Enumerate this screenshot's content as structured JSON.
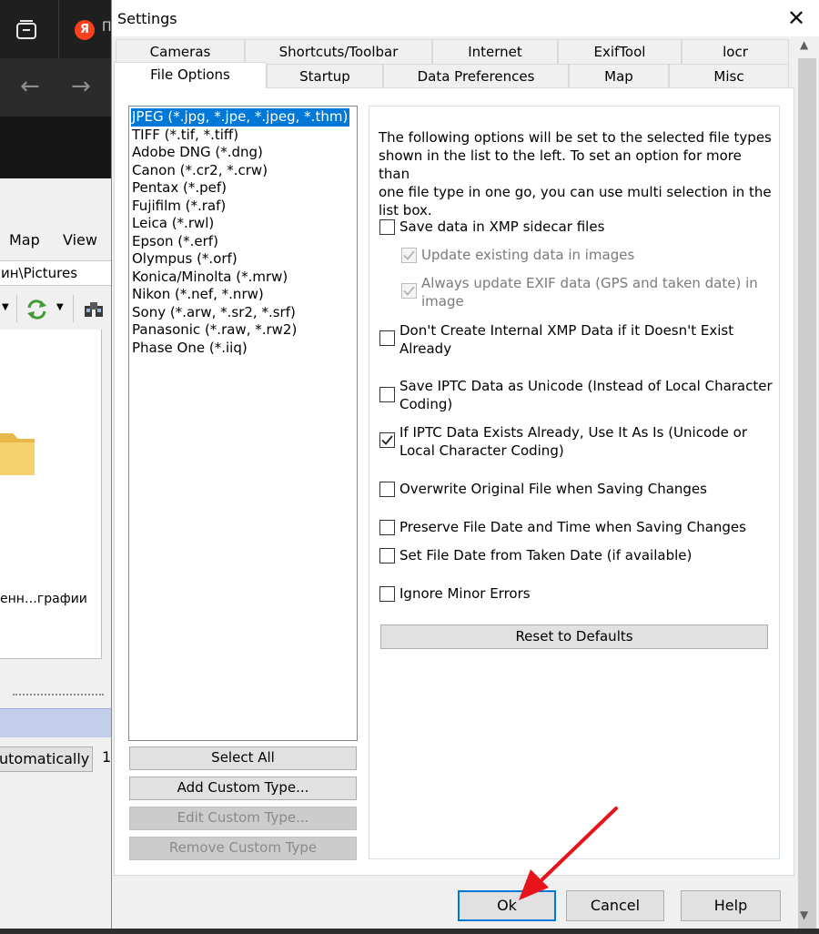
{
  "background_app": {
    "tab_title_fragment": "П",
    "yandex_letter": "Я",
    "menu_map": "Map",
    "menu_view": "View",
    "path_fragment": "ин\\Pictures",
    "folder_label": "енн…графии",
    "auto_button": "utomatically",
    "side_number": "1"
  },
  "dialog": {
    "title": "Settings",
    "tabs_row1": [
      "Cameras",
      "Shortcuts/Toolbar",
      "Internet",
      "ExifTool",
      "locr"
    ],
    "tabs_row2": [
      "File Options",
      "Startup",
      "Data Preferences",
      "Map",
      "Misc"
    ],
    "active_tab": "File Options",
    "file_types": [
      "JPEG (*.jpg, *.jpe, *.jpeg, *.thm)",
      "TIFF (*.tif, *.tiff)",
      "Adobe DNG (*.dng)",
      "Canon (*.cr2, *.crw)",
      "Pentax (*.pef)",
      "Fujifilm (*.raf)",
      "Leica (*.rwl)",
      "Epson (*.erf)",
      "Olympus (*.orf)",
      "Konica/Minolta (*.mrw)",
      "Nikon (*.nef, *.nrw)",
      "Sony (*.arw, *.sr2, *.srf)",
      "Panasonic (*.raw, *.rw2)",
      "Phase One (*.iiq)"
    ],
    "selected_file_type": "JPEG (*.jpg, *.jpe, *.jpeg, *.thm)",
    "list_buttons": {
      "select_all": "Select All",
      "add_custom": "Add Custom Type...",
      "edit_custom": "Edit Custom Type...",
      "remove_custom": "Remove Custom Type"
    },
    "description_lines": [
      "The following options will be set to the selected file types",
      "shown in the list to the left. To set an option for more than",
      "one file type in one go, you can use multi selection in the",
      "list box."
    ],
    "options": {
      "save_xmp": {
        "lines": [
          "Save data in XMP sidecar files"
        ],
        "checked": false
      },
      "update_existing": {
        "lines": [
          "Update existing data in images"
        ],
        "checked": true,
        "disabled": true
      },
      "always_update_exif": {
        "lines": [
          "Always update EXIF data (GPS and taken date) in",
          "image"
        ],
        "checked": true,
        "disabled": true
      },
      "dont_create_xmp": {
        "lines": [
          "Don't Create Internal XMP Data if it Doesn't Exist",
          "Already"
        ],
        "checked": false
      },
      "iptc_unicode": {
        "lines": [
          "Save IPTC Data as Unicode (Instead of Local Character",
          "Coding)"
        ],
        "checked": false
      },
      "iptc_use_as_is": {
        "lines": [
          "If IPTC Data Exists Already, Use It As Is (Unicode or",
          "Local Character Coding)"
        ],
        "checked": true
      },
      "overwrite_original": {
        "lines": [
          "Overwrite Original File when Saving Changes"
        ],
        "checked": false
      },
      "preserve_date": {
        "lines": [
          "Preserve File Date and Time when Saving Changes"
        ],
        "checked": false
      },
      "set_from_taken": {
        "lines": [
          "Set File Date from Taken Date (if available)"
        ],
        "checked": false
      },
      "ignore_minor": {
        "lines": [
          "Ignore Minor Errors"
        ],
        "checked": false
      }
    },
    "reset_button": "Reset to Defaults",
    "footer": {
      "ok": "Ok",
      "cancel": "Cancel",
      "help": "Help"
    }
  },
  "colors": {
    "selection": "#0078d7",
    "annotation_arrow": "#e8141b"
  }
}
